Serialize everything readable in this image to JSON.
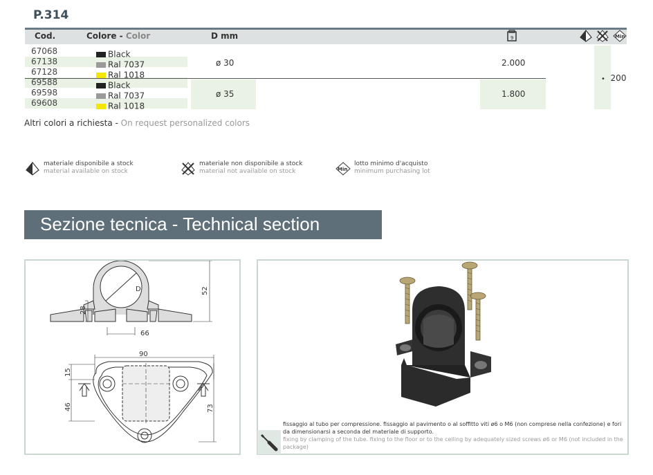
{
  "product_code": "P.314",
  "table": {
    "headers": {
      "cod": "Cod.",
      "colore": "Colore",
      "sep": " - ",
      "color": "Color",
      "dmm": "D mm"
    },
    "rows": [
      {
        "code": "67068",
        "swatch": "#222222",
        "color": "Black"
      },
      {
        "code": "67138",
        "swatch": "#9a9a9a",
        "color": "Ral 7037"
      },
      {
        "code": "67128",
        "swatch": "#f4e600",
        "color": "Ral 1018"
      },
      {
        "code": "69588",
        "swatch": "#222222",
        "color": "Black"
      },
      {
        "code": "69598",
        "swatch": "#9a9a9a",
        "color": "Ral 7037"
      },
      {
        "code": "69608",
        "swatch": "#f4e600",
        "color": "Ral 1018"
      }
    ],
    "groups": [
      {
        "diameter": "ø 30",
        "qty": "2.000"
      },
      {
        "diameter": "ø 35",
        "qty": "1.800"
      }
    ],
    "min_lot": "200"
  },
  "other_colors": {
    "it": "Altri colori a richiesta",
    "sep": " - ",
    "en": "On request personalized colors"
  },
  "legend": [
    {
      "icon": "stock-available-icon",
      "it": "materiale disponibile a stock",
      "en": "material available on stock"
    },
    {
      "icon": "stock-unavailable-icon",
      "it": "materiale non disponibile a stock",
      "en": "material not available on stock"
    },
    {
      "icon": "min-lot-icon",
      "it": "lotto minimo d'acquisto",
      "en": "minimum purchasing lot"
    }
  ],
  "section_title": "Sezione tecnica - Technical section",
  "drawing": {
    "D": "D",
    "d52": "52",
    "d28": "28",
    "d66": "66",
    "d90": "90",
    "d15": "15",
    "d46": "46",
    "d73": "73"
  },
  "caption": {
    "it": "fissaggio al tubo per compressione. fissaggio al pavimento o al soffitto viti ø6 o M6 (non comprese nella confezione) e fori da dimensionarsi a seconda del materiale di supporto.",
    "en": "fixing by clamping of the tube. fixing to the floor or to the ceiling by adequately sized screws ø6 or M6 (not included in the package)"
  },
  "colors": {
    "accent_green": "#e9f2e4",
    "header_bar": "#6b7b86",
    "section_bg": "#5e6f79"
  }
}
